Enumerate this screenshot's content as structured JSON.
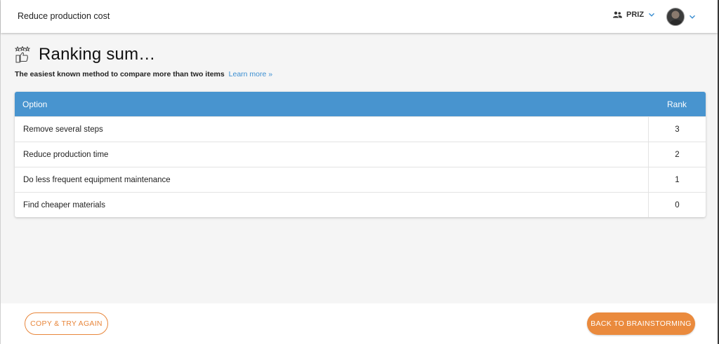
{
  "header": {
    "title": "Reduce production cost",
    "team_name": "PRIZ",
    "team_icon": "users-icon",
    "accent_color": "#3b8ed1"
  },
  "page": {
    "icon": "ranking-icon",
    "title": "Ranking sum…",
    "subtitle": "The easiest known method to compare more than two items",
    "learn_more": "Learn more »"
  },
  "table": {
    "header_color": "#4894cf",
    "columns": [
      "Option",
      "Rank"
    ],
    "rows": [
      {
        "option": "Remove several steps",
        "rank": "3"
      },
      {
        "option": "Reduce production time",
        "rank": "2"
      },
      {
        "option": "Do less frequent equipment maintenance",
        "rank": "1"
      },
      {
        "option": "Find cheaper materials",
        "rank": "0"
      }
    ]
  },
  "footer": {
    "copy_button": "COPY & TRY AGAIN",
    "back_button": "BACK TO BRAINSTORMING",
    "button_color": "#ea8a3d"
  }
}
